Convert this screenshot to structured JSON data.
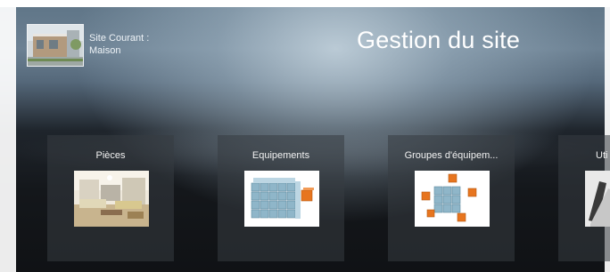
{
  "header": {
    "site_label_line1": "Site Courant :",
    "site_label_line2": "Maison",
    "title": "Gestion du site"
  },
  "cards": [
    {
      "label": "Pièces",
      "icon": "room-photo"
    },
    {
      "label": "Equipements",
      "icon": "cube-blocks-icon"
    },
    {
      "label": "Groupes d'équipem...",
      "icon": "cube-group-icon"
    },
    {
      "label": "Uti",
      "icon": "users-photo"
    }
  ],
  "colors": {
    "text": "#ffffff",
    "card_bg": "#373c42",
    "cube_blue": "#8fb6c9",
    "cube_orange": "#e7751f"
  }
}
